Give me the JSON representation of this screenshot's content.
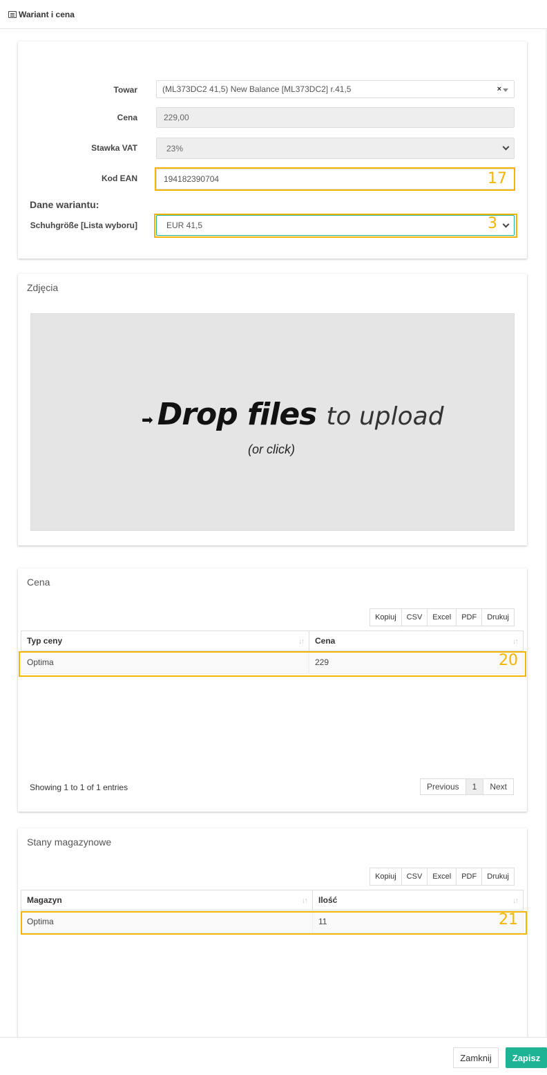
{
  "header": {
    "title": "Wariant i cena",
    "icon": "list-icon"
  },
  "form": {
    "towar_label": "Towar",
    "towar_value": "(ML373DC2 41,5) New Balance [ML373DC2] r.41,5",
    "towar_clear": "×",
    "cena_label": "Cena",
    "cena_value": "229,00",
    "vat_label": "Stawka VAT",
    "vat_value": "23%",
    "ean_label": "Kod EAN",
    "ean_value": "194182390704",
    "variant_heading": "Dane wariantu:",
    "size_label": "Schuhgröße [Lista wyboru]",
    "size_value": "EUR 41,5"
  },
  "annotations": {
    "ean": "17",
    "size": "3",
    "price_row": "20",
    "stock_row": "21"
  },
  "photos": {
    "title": "Zdjęcia",
    "drop_bold": "Drop files",
    "drop_light": "to upload",
    "drop_sub": "(or click)"
  },
  "export_buttons": [
    "Kopiuj",
    "CSV",
    "Excel",
    "PDF",
    "Drukuj"
  ],
  "price_table": {
    "title": "Cena",
    "columns": [
      "Typ ceny",
      "Cena"
    ],
    "rows": [
      [
        "Optima",
        "229"
      ]
    ],
    "info": "Showing 1 to 1 of 1 entries",
    "pager": [
      "Previous",
      "1",
      "Next"
    ]
  },
  "stock_table": {
    "title": "Stany magazynowe",
    "columns": [
      "Magazyn",
      "Ilość"
    ],
    "rows": [
      [
        "Optima",
        "11"
      ]
    ]
  },
  "footer": {
    "close": "Zamknij",
    "save": "Zapisz"
  },
  "colors": {
    "highlight": "#f5b400",
    "save_button": "#1fb395"
  }
}
